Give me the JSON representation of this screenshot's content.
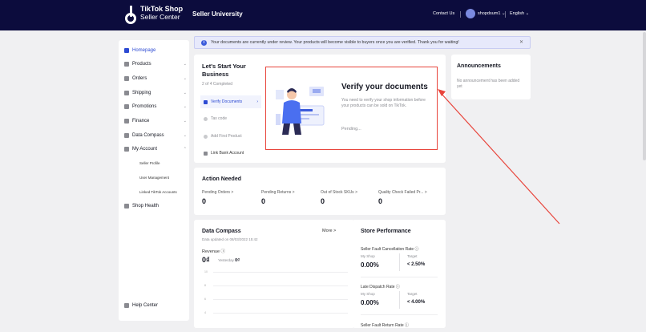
{
  "topbar": {
    "brand_line1": "TikTok Shop",
    "brand_line2": "Seller Center",
    "seller_university": "Seller University",
    "contact_us": "Contact Us",
    "user_name": "shopdsum1",
    "language": "English"
  },
  "banner": {
    "message": "Your documents are currently under review. Your products will become visible to buyers once you are verified. Thank you for waiting!"
  },
  "sidebar": {
    "items": [
      {
        "label": "Homepage"
      },
      {
        "label": "Products"
      },
      {
        "label": "Orders"
      },
      {
        "label": "Shipping"
      },
      {
        "label": "Promotions"
      },
      {
        "label": "Finance"
      },
      {
        "label": "Data Compass"
      },
      {
        "label": "My Account"
      },
      {
        "label": "Shop Health"
      },
      {
        "label": "Help Center"
      }
    ],
    "sub_items": [
      {
        "label": "Seller Profile"
      },
      {
        "label": "User Management"
      },
      {
        "label": "Linked TikTok Accounts"
      }
    ]
  },
  "start": {
    "title": "Let's Start Your Business",
    "progress": "2 of 4 Completed",
    "steps": [
      {
        "label": "Verify Documents"
      },
      {
        "label": "Tax code"
      },
      {
        "label": "Add First Product"
      },
      {
        "label": "Link Bank Account"
      }
    ],
    "verify_title": "Verify your documents",
    "verify_desc": "You need to verify your shop information before your products can be sold on TikTok.",
    "verify_status": "Pending..."
  },
  "announcements": {
    "title": "Announcements",
    "empty_text": "No announcement has been added yet"
  },
  "action_needed": {
    "title": "Action Needed",
    "metrics": [
      {
        "label": "Pending Orders >",
        "value": "0"
      },
      {
        "label": "Pending Returns >",
        "value": "0"
      },
      {
        "label": "Out of Stock SKUs >",
        "value": "0"
      },
      {
        "label": "Quality Check Failed Pr... >",
        "value": "0"
      }
    ]
  },
  "data_compass": {
    "title": "Data Compass",
    "more": "More >",
    "updated": "Data updated on 08/03/2022 15:42",
    "revenue_label": "Revenue ⓘ",
    "revenue_value": "0₫",
    "yesterday_label": "Yesterday",
    "yesterday_value": "0₫",
    "axis_labels": [
      "10",
      "8",
      "6",
      "4"
    ]
  },
  "store_performance": {
    "title": "Store Performance",
    "my_shop_label": "My Shop",
    "target_label": "Target",
    "metrics": [
      {
        "label": "Seller Fault Cancellation Rate ⓘ",
        "my_shop": "0.00%",
        "target": "< 2.50%"
      },
      {
        "label": "Late Dispatch Rate ⓘ",
        "my_shop": "0.00%",
        "target": "< 4.00%"
      },
      {
        "label": "Seller Fault Return Rate ⓘ"
      }
    ]
  },
  "colors": {
    "topbar": "#0c0c3d",
    "accent": "#2c4ad3",
    "highlight_border": "#e8453c"
  }
}
